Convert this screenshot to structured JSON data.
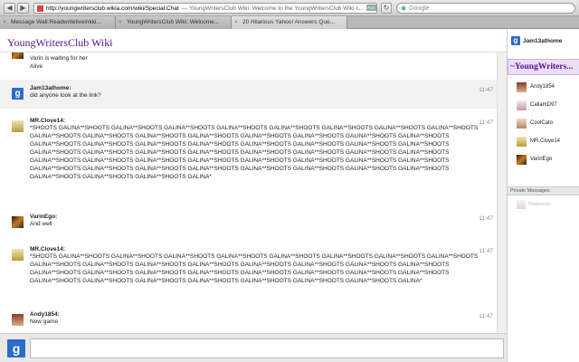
{
  "browser": {
    "url": "http://youngwritersclub.wikia.com/wiki/Special:Chat",
    "window_title": "— YoungWritersClub Wiki: Welcome to the YoungWritersClub Wiki c...",
    "rss_label": "RSS",
    "search_placeholder": "Google",
    "tabs": [
      {
        "label": "Message Wall:Readwriteliveinkki..."
      },
      {
        "label": "YoungWritersClub Wiki: Welcome..."
      },
      {
        "label": "20 Hilarious Yahoo! Answers Que..."
      }
    ]
  },
  "wiki": {
    "title": "YoungWritersClub Wiki",
    "current_user": "Jam13athome"
  },
  "chat": {
    "messages": [
      {
        "user": "",
        "text": "Varin is waiting for her\nAlive",
        "time": ""
      },
      {
        "user": "Jam13athome:",
        "text": "did anyone look at the link?",
        "time": "11:47"
      },
      {
        "user": "MR.Clove14:",
        "text": "*SHOOTS GALINA**SHOOTS GALINA**SHOOTS GALINA**SHOOTS GALINA**SHOOTS GALINA**SHOOTS GALINA**SHOOTS GALINA**SHOOTS GALINA**SHOOTS GALINA**SHOOTS GALINA**SHOOTS GALINA**SHOOTS GALINA**SHOOTS GALINA**SHOOTS GALINA**SHOOTS GALINA**SHOOTS GALINA**SHOOTS GALINA**SHOOTS GALINA**SHOOTS GALINA**SHOOTS GALINA**SHOOTS GALINA**SHOOTS GALINA**SHOOTS GALINA**SHOOTS GALINA**SHOOTS GALINA**SHOOTS GALINA**SHOOTS GALINA**SHOOTS GALINA**SHOOTS GALINA**SHOOTS GALINA**SHOOTS GALINA**SHOOTS GALINA**SHOOTS GALINA**SHOOTS GALINA**SHOOTS GALINA**SHOOTS GALINA**SHOOTS GALINA**SHOOTS GALINA**SHOOTS GALINA**SHOOTS GALINA**SHOOTS GALINA**SHOOTS GALINA**SHOOTS GALINA**SHOOTS GALINA**SHOOTS GALINA**SHOOTS GALINA**SHOOTS GALINA**SHOOTS GALINA**SHOOTS GALINA**SHOOTS GALINA**SHOOTS GALINA**SHOOTS GALINA*",
        "time": "11:47"
      },
      {
        "user": "VarinEgo:",
        "text": "And well",
        "time": "11:47"
      },
      {
        "user": "MR.Clove14:",
        "text": "*SHOOTS GALINA**SHOOTS GALINA**SHOOTS GALINA**SHOOTS GALINA**SHOOTS GALINA**SHOOTS GALINA**SHOOTS GALINA**SHOOTS GALINA**SHOOTS GALINA**SHOOTS GALINA**SHOOTS GALINA**SHOOTS GALINA**SHOOTS GALINA**SHOOTS GALINA**SHOOTS GALINA**SHOOTS GALINA**SHOOTS GALINA**SHOOTS GALINA**SHOOTS GALINA**SHOOTS GALINA**SHOOTS GALINA**SHOOTS GALINA**SHOOTS GALINA**SHOOTS GALINA**SHOOTS GALINA**SHOOTS GALINA**SHOOTS GALINA**SHOOTS GALINA**SHOOTS GALINA**SHOOTS GALINA**SHOOTS GALINA**SHOOTS GALINA*",
        "time": "11:47"
      },
      {
        "user": "Andy1854:",
        "text": "New game",
        "time": "11:47"
      }
    ]
  },
  "rail": {
    "room_name": "~YoungWriters...",
    "users": [
      "Andy1854",
      "CallamD97",
      "CoolCato",
      "MR.Clove14",
      "VarinEgo"
    ],
    "private_messages_header": "Private Messages",
    "private_user": "Dedaxcon"
  },
  "icons": {
    "back": "back-arrow-icon",
    "forward": "forward-arrow-icon",
    "reload": "reload-icon",
    "google_avatar": "google-g-icon"
  },
  "colors": {
    "brand": "#5b0d91",
    "room_bg": "#eadff5",
    "google_blue": "#2d6bcc"
  }
}
